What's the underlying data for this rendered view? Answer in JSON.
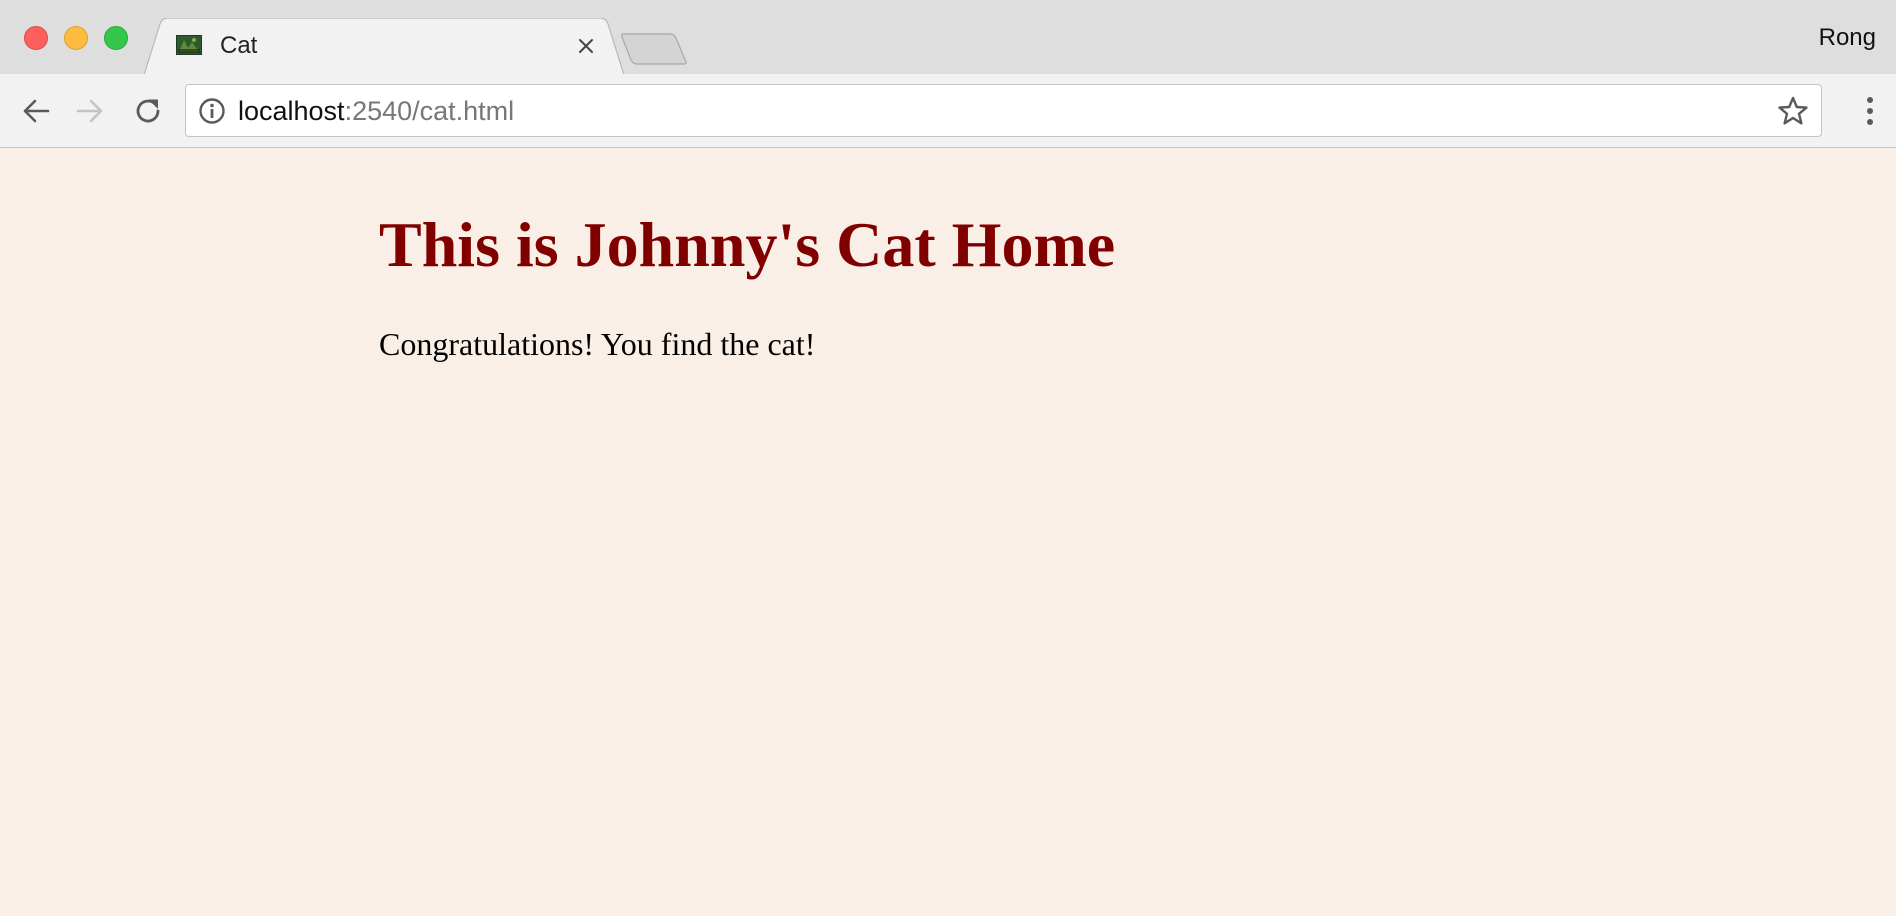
{
  "browser": {
    "profile_name": "Rong",
    "tab": {
      "title": "Cat",
      "favicon": "cat-photo-favicon",
      "close_icon": "close-icon"
    },
    "new_tab_icon": "new-tab-icon",
    "toolbar": {
      "back_icon": "back-arrow-icon",
      "forward_icon": "forward-arrow-icon",
      "reload_icon": "reload-icon",
      "info_icon": "info-icon",
      "bookmark_icon": "star-icon",
      "menu_icon": "kebab-menu-icon"
    },
    "address_bar": {
      "host": "localhost",
      "rest": ":2540/cat.html"
    }
  },
  "page": {
    "heading": "This is Johnny's Cat Home",
    "paragraph": "Congratulations! You find the cat!",
    "background_color": "#faefe6",
    "heading_color": "#800000"
  }
}
